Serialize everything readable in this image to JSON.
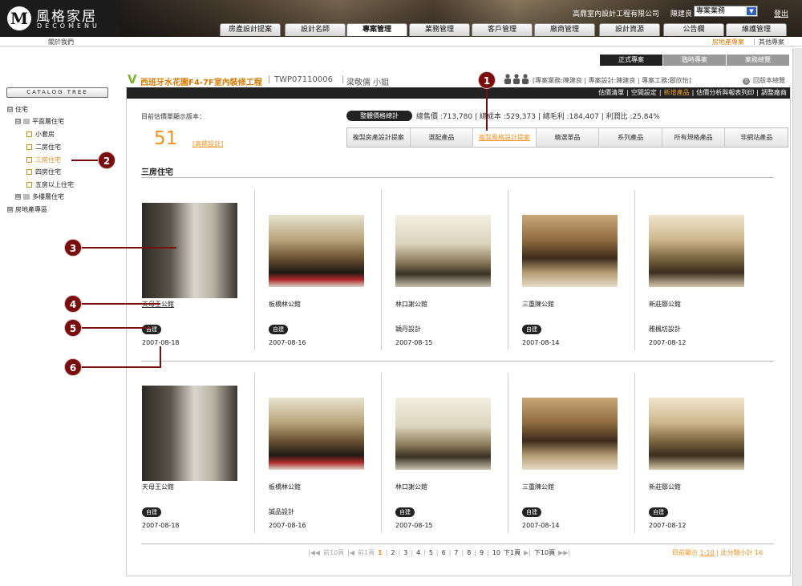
{
  "header": {
    "logo_mark": "M",
    "logo_cn": "風格家居",
    "logo_en": "DECOMENU",
    "company": "高鼎室內設計工程有限公司",
    "username": "陳建良",
    "role": "專案業務",
    "logout": "登出"
  },
  "nav": [
    "房產設計提案",
    "設計名師",
    "專案管理",
    "業務管理",
    "客戶管理",
    "廠商管理",
    "設計資源",
    "公告欄",
    "維護管理"
  ],
  "subbar": {
    "about": "關於我們",
    "right1": "房地產專案",
    "sep": "|",
    "right2": "其他專案"
  },
  "status_tabs": [
    "正式專案",
    "臨時專案",
    "案務總覽"
  ],
  "project": {
    "v": "V",
    "title": "西班牙水花園F4-7F室內裝修工程",
    "sep": "|",
    "code": "TWP07110006",
    "client": "梁敬儒 小姐",
    "staff": "[專案業務:陳建良  |  專案設計:陳建良  |  專案工務:鄒欣怡]",
    "back": "回版本總覽",
    "back_icon": "⇧"
  },
  "actions": [
    "估價清單",
    "|",
    "空間設定",
    "|",
    "新增產品",
    "|",
    "估價分析與報表列印",
    "|",
    "調整廠商"
  ],
  "estimate": {
    "label": "目前估價單顯示版本：",
    "count": "51",
    "design": "[高鼎設計]"
  },
  "price": {
    "button": "整體價格總計",
    "stats": "總售價 :713,780  |  總成本 :529,373  |  總毛利 :184,407  |  利潤比 :25.84%"
  },
  "category_tabs": [
    "複製房產設計提案",
    "選配產品",
    "複製風格設計提案",
    "精選單品",
    "系列產品",
    "所有規格產品",
    "非網站產品"
  ],
  "section_title": "三房住宅",
  "tree": {
    "button": "CATALOG TREE",
    "items": [
      {
        "label": "住宅",
        "mark": "⊟"
      },
      {
        "label": "平面層住宅",
        "mark": "⊟"
      },
      {
        "label": "小套房"
      },
      {
        "label": "二房住宅"
      },
      {
        "label": "三房住宅"
      },
      {
        "label": "四房住宅"
      },
      {
        "label": "五房以上住宅"
      },
      {
        "label": "多樓層住宅",
        "mark": "⊞"
      },
      {
        "label": "房地產專區",
        "mark": "⊞"
      }
    ]
  },
  "products": [
    {
      "name": "天母王公館",
      "badge": "自建",
      "note": "",
      "date": "2007-08-18"
    },
    {
      "name": "板橋林公館",
      "badge": "自建",
      "note": "",
      "date": "2007-08-16"
    },
    {
      "name": "林口謝公館",
      "badge": "",
      "note": "穎丹設計",
      "date": "2007-08-15"
    },
    {
      "name": "三重陳公館",
      "badge": "自建",
      "note": "",
      "date": "2007-08-14"
    },
    {
      "name": "新莊鄒公館",
      "badge": "",
      "note": "雅楓坊設計",
      "date": "2007-08-12"
    },
    {
      "name": "天母王公館",
      "badge": "自建",
      "note": "",
      "date": "2007-08-18"
    },
    {
      "name": "板橋林公館",
      "badge": "",
      "note": "誠品設計",
      "date": "2007-08-16"
    },
    {
      "name": "林口謝公館",
      "badge": "自建",
      "note": "",
      "date": "2007-08-15"
    },
    {
      "name": "三重陳公館",
      "badge": "自建",
      "note": "",
      "date": "2007-08-14"
    },
    {
      "name": "新莊鄒公館",
      "badge": "自建",
      "note": "",
      "date": "2007-08-12"
    }
  ],
  "pager": {
    "first": "前10頁",
    "prev": "前1頁",
    "pages": [
      "1",
      "2",
      "3",
      "4",
      "5",
      "6",
      "7",
      "8",
      "9",
      "10"
    ],
    "next": "下1頁",
    "last": "下10頁",
    "summary_prefix": "目前顯示",
    "summary_range": "1-10",
    "summary_suffix": "| 此分類小計 16"
  },
  "callouts": [
    "1",
    "2",
    "3",
    "4",
    "5",
    "6"
  ]
}
